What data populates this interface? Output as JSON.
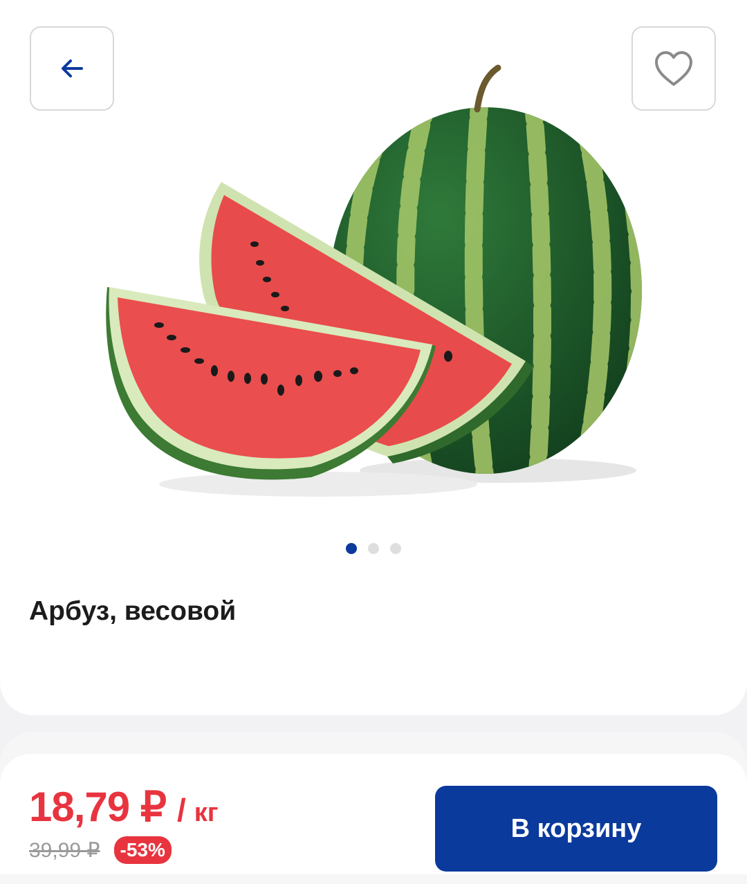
{
  "product": {
    "title": "Арбуз, весовой",
    "gallery_total": 3,
    "gallery_active": 1
  },
  "header": {
    "back_icon": "arrow-left-icon",
    "favorite_icon": "heart-outline-icon"
  },
  "pricing": {
    "current": "18,79 ₽",
    "separator": "/",
    "unit": "кг",
    "old": "39,99 ₽",
    "discount": "-53%"
  },
  "actions": {
    "add_to_cart_label": "В корзину"
  },
  "colors": {
    "accent": "#0a3a9c",
    "price": "#e8343f",
    "discount_badge": "#e8343f"
  }
}
